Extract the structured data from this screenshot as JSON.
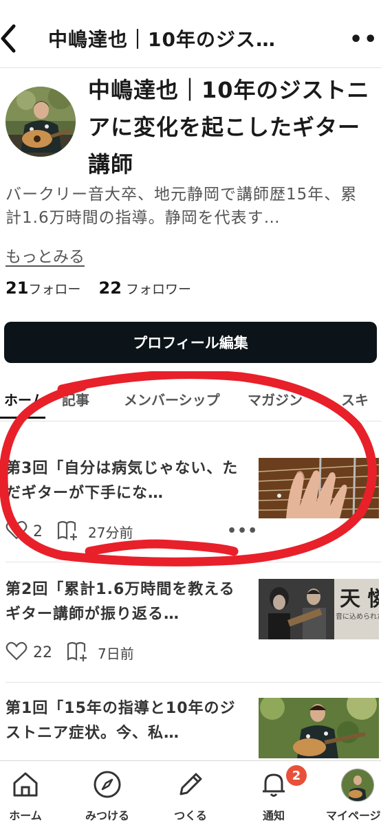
{
  "header": {
    "title": "中嶋達也｜10年のジス…",
    "back_icon": "chevron-left-icon",
    "more_icon": "more-horizontal-icon",
    "more_text": "•••"
  },
  "profile": {
    "name": "中嶋達也｜10年のジストニアに変化を起こしたギター講師",
    "bio": "バークリー音大卒、地元静岡で講師歴15年、累計1.6万時間の指導。静岡を代表す…",
    "more_link": "もっとみる",
    "follow_count": "21",
    "follow_label": "フォロー",
    "follower_count": "22",
    "follower_label": "フォロワー",
    "edit_button": "プロフィール編集"
  },
  "tabs": [
    {
      "label": "ホーム",
      "active": true
    },
    {
      "label": "記事"
    },
    {
      "label": "メンバーシップ"
    },
    {
      "label": "マガジン"
    },
    {
      "label": "スキ"
    }
  ],
  "articles": [
    {
      "title": "第3回「自分は病気じゃない、ただギターが下手にな…",
      "likes": "2",
      "time": "27分前",
      "more": "•••"
    },
    {
      "title": "第2回「累計1.6万時間を教えるギター講師が振り返る…",
      "likes": "22",
      "time": "7日前"
    },
    {
      "title": "第1回「15年の指導と10年のジストニア症状。今、私…"
    }
  ],
  "thumb2_text": "天 憐",
  "thumb2_sub": "音に込められた",
  "bottom_nav": [
    {
      "label": "ホーム",
      "icon": "home-icon"
    },
    {
      "label": "みつける",
      "icon": "compass-icon"
    },
    {
      "label": "つくる",
      "icon": "pencil-icon"
    },
    {
      "label": "通知",
      "icon": "bell-icon",
      "badge": "2"
    },
    {
      "label": "マイページ",
      "icon": "avatar-icon"
    }
  ],
  "colors": {
    "annotation": "#e8202a",
    "badge": "#e8503a",
    "button": "#0c1419"
  }
}
